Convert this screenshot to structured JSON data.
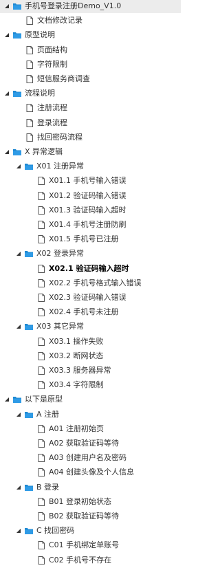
{
  "tree": [
    {
      "level": 0,
      "type": "folder",
      "expanded": true,
      "selected": true,
      "label": "手机号登录注册Demo_V1.0"
    },
    {
      "level": 1,
      "type": "page",
      "label": "文档修改记录"
    },
    {
      "level": 0,
      "type": "folder",
      "expanded": true,
      "label": "原型说明"
    },
    {
      "level": 1,
      "type": "page",
      "label": "页面结构"
    },
    {
      "level": 1,
      "type": "page",
      "label": "字符限制"
    },
    {
      "level": 1,
      "type": "page",
      "label": "短信服务商调查"
    },
    {
      "level": 0,
      "type": "folder",
      "expanded": true,
      "label": "流程说明"
    },
    {
      "level": 1,
      "type": "page",
      "label": "注册流程"
    },
    {
      "level": 1,
      "type": "page",
      "label": "登录流程"
    },
    {
      "level": 1,
      "type": "page",
      "label": "找回密码流程"
    },
    {
      "level": 0,
      "type": "folder",
      "expanded": true,
      "label": "X 异常逻辑"
    },
    {
      "level": 1,
      "type": "folder",
      "expanded": true,
      "label": "X01 注册异常"
    },
    {
      "level": 2,
      "type": "page",
      "label": "X01.1 手机号输入错误"
    },
    {
      "level": 2,
      "type": "page",
      "label": "X01.2 验证码输入错误"
    },
    {
      "level": 2,
      "type": "page",
      "label": "X01.3 验证码输入超时"
    },
    {
      "level": 2,
      "type": "page",
      "label": "X01.4 手机号注册防刷"
    },
    {
      "level": 2,
      "type": "page",
      "label": "X01.5 手机号已注册"
    },
    {
      "level": 1,
      "type": "folder",
      "expanded": true,
      "label": "X02 登录异常"
    },
    {
      "level": 2,
      "type": "page",
      "bold": true,
      "label": "X02.1 验证码输入超时"
    },
    {
      "level": 2,
      "type": "page",
      "label": "X02.2 手机号格式输入错误"
    },
    {
      "level": 2,
      "type": "page",
      "label": "X02.3 验证码输入错误"
    },
    {
      "level": 2,
      "type": "page",
      "label": "X02.4 手机号未注册"
    },
    {
      "level": 1,
      "type": "folder",
      "expanded": true,
      "label": "X03 其它异常"
    },
    {
      "level": 2,
      "type": "page",
      "label": "X03.1 操作失败"
    },
    {
      "level": 2,
      "type": "page",
      "label": "X03.2 断网状态"
    },
    {
      "level": 2,
      "type": "page",
      "label": "X03.3 服务器异常"
    },
    {
      "level": 2,
      "type": "page",
      "label": "X03.4 字符限制"
    },
    {
      "level": 0,
      "type": "folder",
      "expanded": true,
      "label": "以下是原型"
    },
    {
      "level": 1,
      "type": "folder",
      "expanded": true,
      "label": "A 注册"
    },
    {
      "level": 2,
      "type": "page",
      "label": "A01 注册初始页"
    },
    {
      "level": 2,
      "type": "page",
      "label": "A02 获取验证码等待"
    },
    {
      "level": 2,
      "type": "page",
      "label": "A03 创建用户名及密码"
    },
    {
      "level": 2,
      "type": "page",
      "label": "A04 创建头像及个人信息"
    },
    {
      "level": 1,
      "type": "folder",
      "expanded": true,
      "label": "B 登录"
    },
    {
      "level": 2,
      "type": "page",
      "label": "B01 登录初始状态"
    },
    {
      "level": 2,
      "type": "page",
      "label": "B02 获取验证码等待"
    },
    {
      "level": 1,
      "type": "folder",
      "expanded": true,
      "label": "C 找回密码"
    },
    {
      "level": 2,
      "type": "page",
      "label": "C01 手机绑定单账号"
    },
    {
      "level": 2,
      "type": "page",
      "label": "C02 手机号不存在"
    }
  ],
  "colors": {
    "folder": "#1e88d2",
    "folder_tab": "#1e88d2",
    "arrow": "#333333",
    "page_stroke": "#555555",
    "selected_bg": "#ececec"
  }
}
